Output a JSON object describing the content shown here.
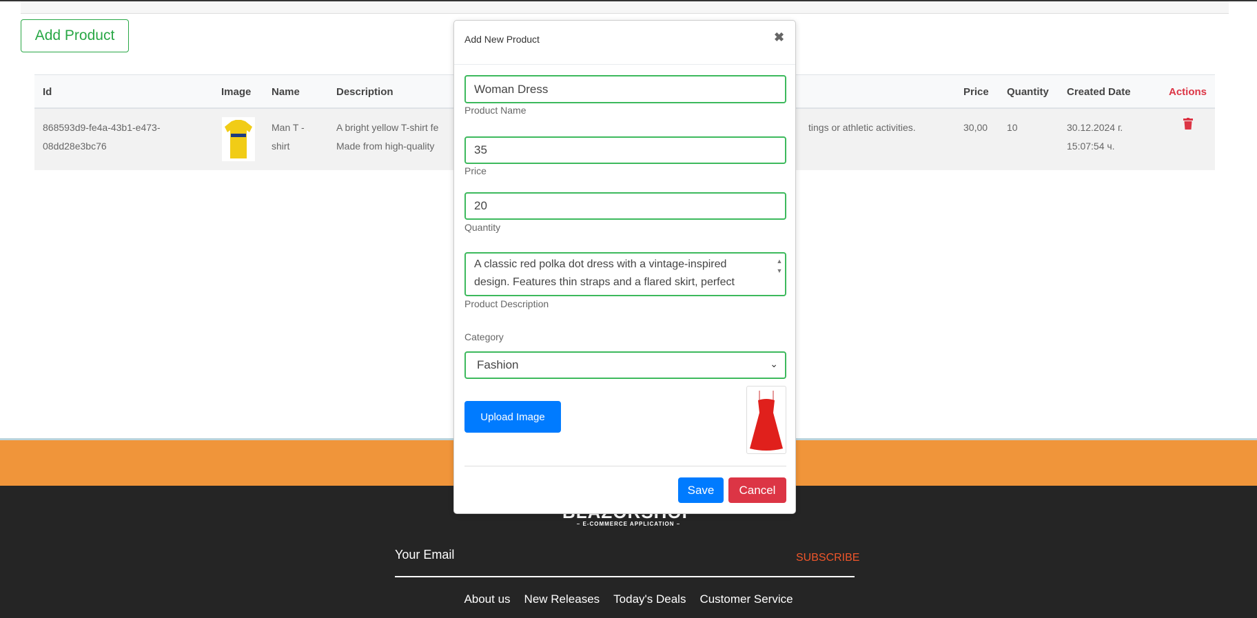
{
  "page": {
    "add_product_label": "Add Product"
  },
  "table": {
    "headers": [
      "Id",
      "Image",
      "Name",
      "Description",
      "Price",
      "Quantity",
      "Created Date",
      "Actions"
    ],
    "rows": [
      {
        "id_line1": "868593d9-fe4a-43b1-e473-",
        "id_line2": "08dd28e3bc76",
        "image": "yellow-tshirt",
        "name_line1": "Man T -",
        "name_line2": "shirt",
        "desc_line1_start": "A bright yellow T-shirt fe",
        "desc_line1_end": "tings or athletic activities.",
        "desc_line2": "Made from high-quality",
        "price": "30,00",
        "quantity": "10",
        "date_line1": "30.12.2024 г.",
        "date_line2": "15:07:54 ч.",
        "action_icon": "trash-icon"
      }
    ]
  },
  "modal": {
    "title": "Add New Product",
    "close_icon": "close-icon",
    "name_value": "Woman Dress",
    "name_label": "Product Name",
    "price_value": "35",
    "price_label": "Price",
    "quantity_value": "20",
    "quantity_label": "Quantity",
    "description_value": "A classic red polka dot dress with a vintage-inspired design. Features thin straps and a flared skirt, perfect",
    "description_label": "Product Description",
    "category_label": "Category",
    "category_value": "Fashion",
    "upload_label": "Upload Image",
    "preview_image": "red-polka-dot-dress",
    "save_label": "Save",
    "cancel_label": "Cancel"
  },
  "footer": {
    "logo_text": "BLAZORSHOP",
    "logo_sub": "– E-COMMERCE APPLICATION –",
    "email_label": "Your Email",
    "subscribe_label": "SUBSCRIBE",
    "links": [
      "About us",
      "New Releases",
      "Today's Deals",
      "Customer Service"
    ]
  },
  "colors": {
    "accent_green": "#28a745",
    "primary": "#007bff",
    "danger": "#dc3545",
    "footer_bg": "#252525",
    "subscribe": "#f0562a"
  }
}
